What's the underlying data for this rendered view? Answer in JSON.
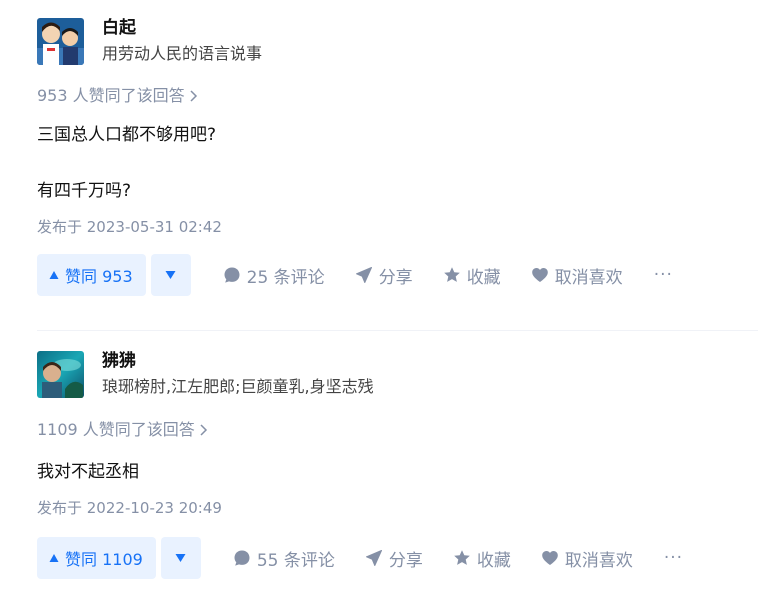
{
  "answers": [
    {
      "author": {
        "name": "白起",
        "bio": "用劳动人民的语言说事"
      },
      "voters_text": "953 人赞同了该回答",
      "content": [
        "三国总人口都不够用吧?",
        "有四千万吗?"
      ],
      "time": "发布于 2023-05-31 02:42",
      "actions": {
        "vote_up": "赞同 953",
        "comments": "25 条评论",
        "share": "分享",
        "collect": "收藏",
        "like": "取消喜欢",
        "more": "···"
      }
    },
    {
      "author": {
        "name": "狒狒",
        "bio": "琅琊榜肘,江左肥郎;巨颜童乳,身坚志残"
      },
      "voters_text": "1109 人赞同了该回答",
      "content": [
        "我对不起丞相"
      ],
      "time": "发布于 2022-10-23 20:49",
      "actions": {
        "vote_up": "赞同 1109",
        "comments": "55 条评论",
        "share": "分享",
        "collect": "收藏",
        "like": "取消喜欢",
        "more": "···"
      }
    }
  ],
  "colors": {
    "brand_blue": "#1772f6",
    "vote_bg": "#e9f2ff",
    "meta_gray": "#8590a6",
    "text": "#121212"
  }
}
